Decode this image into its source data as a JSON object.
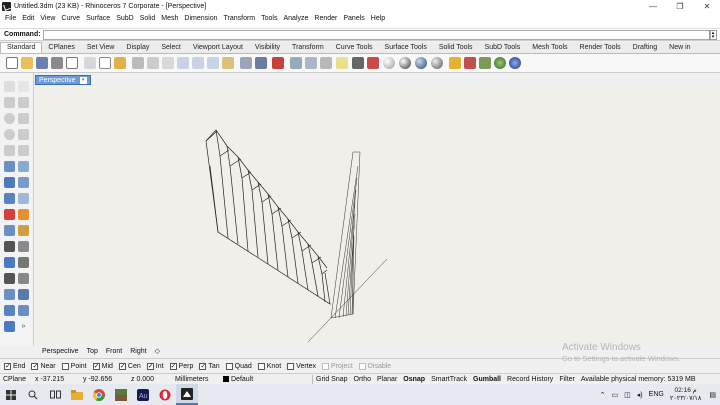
{
  "window": {
    "title": "Untitled.3dm (23 KB) - Rhinoceros 7 Corporate - [Perspective]",
    "controls": [
      "—",
      "❐",
      "✕"
    ]
  },
  "menu": [
    "File",
    "Edit",
    "View",
    "Curve",
    "Surface",
    "SubD",
    "Solid",
    "Mesh",
    "Dimension",
    "Transform",
    "Tools",
    "Analyze",
    "Render",
    "Panels",
    "Help"
  ],
  "command": {
    "label": "Command:",
    "value": ""
  },
  "tabs": [
    "Standard",
    "CPlanes",
    "Set View",
    "Display",
    "Select",
    "Viewport Layout",
    "Visibility",
    "Transform",
    "Curve Tools",
    "Surface Tools",
    "Solid Tools",
    "SubD Tools",
    "Mesh Tools",
    "Render Tools",
    "Drafting",
    "New in"
  ],
  "active_tab": "Standard",
  "viewport": {
    "name": "Perspective",
    "dropdown": "▾"
  },
  "view_tabs": [
    "Perspective",
    "Top",
    "Front",
    "Right",
    "◇"
  ],
  "osnaps": [
    {
      "label": "End",
      "checked": true
    },
    {
      "label": "Near",
      "checked": true
    },
    {
      "label": "Point",
      "checked": false
    },
    {
      "label": "Mid",
      "checked": true
    },
    {
      "label": "Cen",
      "checked": true
    },
    {
      "label": "Int",
      "checked": true
    },
    {
      "label": "Perp",
      "checked": true
    },
    {
      "label": "Tan",
      "checked": true
    },
    {
      "label": "Quad",
      "checked": false
    },
    {
      "label": "Knot",
      "checked": false
    },
    {
      "label": "Vertex",
      "checked": false
    },
    {
      "label": "Project",
      "checked": false,
      "disabled": true
    },
    {
      "label": "Disable",
      "checked": false,
      "disabled": true
    }
  ],
  "status": {
    "cplane": "CPlane",
    "x": "x -37.215",
    "y": "y -92.656",
    "z": "z 0.000",
    "units": "Millimeters",
    "layer": "Default",
    "toggles": [
      {
        "label": "Grid Snap",
        "bold": false
      },
      {
        "label": "Ortho",
        "bold": false
      },
      {
        "label": "Planar",
        "bold": false
      },
      {
        "label": "Osnap",
        "bold": true
      },
      {
        "label": "SmartTrack",
        "bold": false
      },
      {
        "label": "Gumball",
        "bold": true
      },
      {
        "label": "Record History",
        "bold": false
      },
      {
        "label": "Filter",
        "bold": false
      }
    ],
    "memory": "Available physical memory: 5319 MB"
  },
  "watermark": {
    "line1": "Activate Windows",
    "line2": "Go to Settings to activate Windows."
  },
  "tray": {
    "lang": "ENG",
    "time": "02:16 م",
    "date": "٢٠٢٣/٠٧/١٨"
  },
  "colors": {
    "accent": "#6a9ad8",
    "viewport_bg": "#f1efe9",
    "taskbar": "#e6eaf0"
  }
}
